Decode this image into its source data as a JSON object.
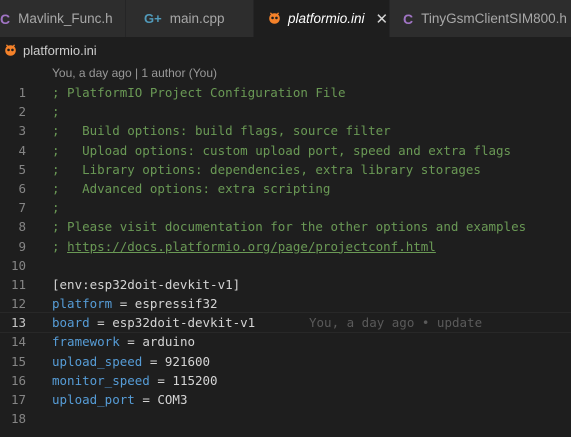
{
  "tabs": [
    {
      "label": "Mavlink_Func.h",
      "icon": "c-icon",
      "active": false
    },
    {
      "label": "main.cpp",
      "icon": "cpp-icon",
      "active": false
    },
    {
      "label": "platformio.ini",
      "icon": "platformio-icon",
      "active": true
    },
    {
      "label": "TinyGsmClientSIM800.h",
      "icon": "c-icon",
      "active": false
    }
  ],
  "breadcrumb": {
    "file": "platformio.ini"
  },
  "codelens": {
    "text": "You, a day ago | 1 author (You)"
  },
  "lines": {
    "l1": {
      "num": "1",
      "text": "; PlatformIO Project Configuration File"
    },
    "l2": {
      "num": "2",
      "text": ";"
    },
    "l3": {
      "num": "3",
      "text": ";   Build options: build flags, source filter"
    },
    "l4": {
      "num": "4",
      "text": ";   Upload options: custom upload port, speed and extra flags"
    },
    "l5": {
      "num": "5",
      "text": ";   Library options: dependencies, extra library storages"
    },
    "l6": {
      "num": "6",
      "text": ";   Advanced options: extra scripting"
    },
    "l7": {
      "num": "7",
      "text": ";"
    },
    "l8": {
      "num": "8",
      "text": "; Please visit documentation for the other options and examples"
    },
    "l9": {
      "num": "9",
      "prefix": "; ",
      "link": "https://docs.platformio.org/page/projectconf.html"
    },
    "l10": {
      "num": "10"
    },
    "l11": {
      "num": "11",
      "text": "[env:esp32doit-devkit-v1]"
    },
    "l12": {
      "num": "12",
      "key": "platform",
      "value": "espressif32"
    },
    "l13": {
      "num": "13",
      "key": "board",
      "value": "esp32doit-devkit-v1",
      "blame": "You, a day ago • update"
    },
    "l14": {
      "num": "14",
      "key": "framework",
      "value": "arduino"
    },
    "l15": {
      "num": "15",
      "key": "upload_speed",
      "value": "921600"
    },
    "l16": {
      "num": "16",
      "key": "monitor_speed",
      "value": "115200"
    },
    "l17": {
      "num": "17",
      "key": "upload_port",
      "value": "COM3"
    },
    "l18": {
      "num": "18"
    }
  },
  "syntax": {
    "eq": " = "
  },
  "colors": {
    "comment": "#6a9955",
    "key": "#569cd6",
    "platformio": "#f5822a",
    "c_header": "#a074c4",
    "cpp": "#519aba"
  }
}
